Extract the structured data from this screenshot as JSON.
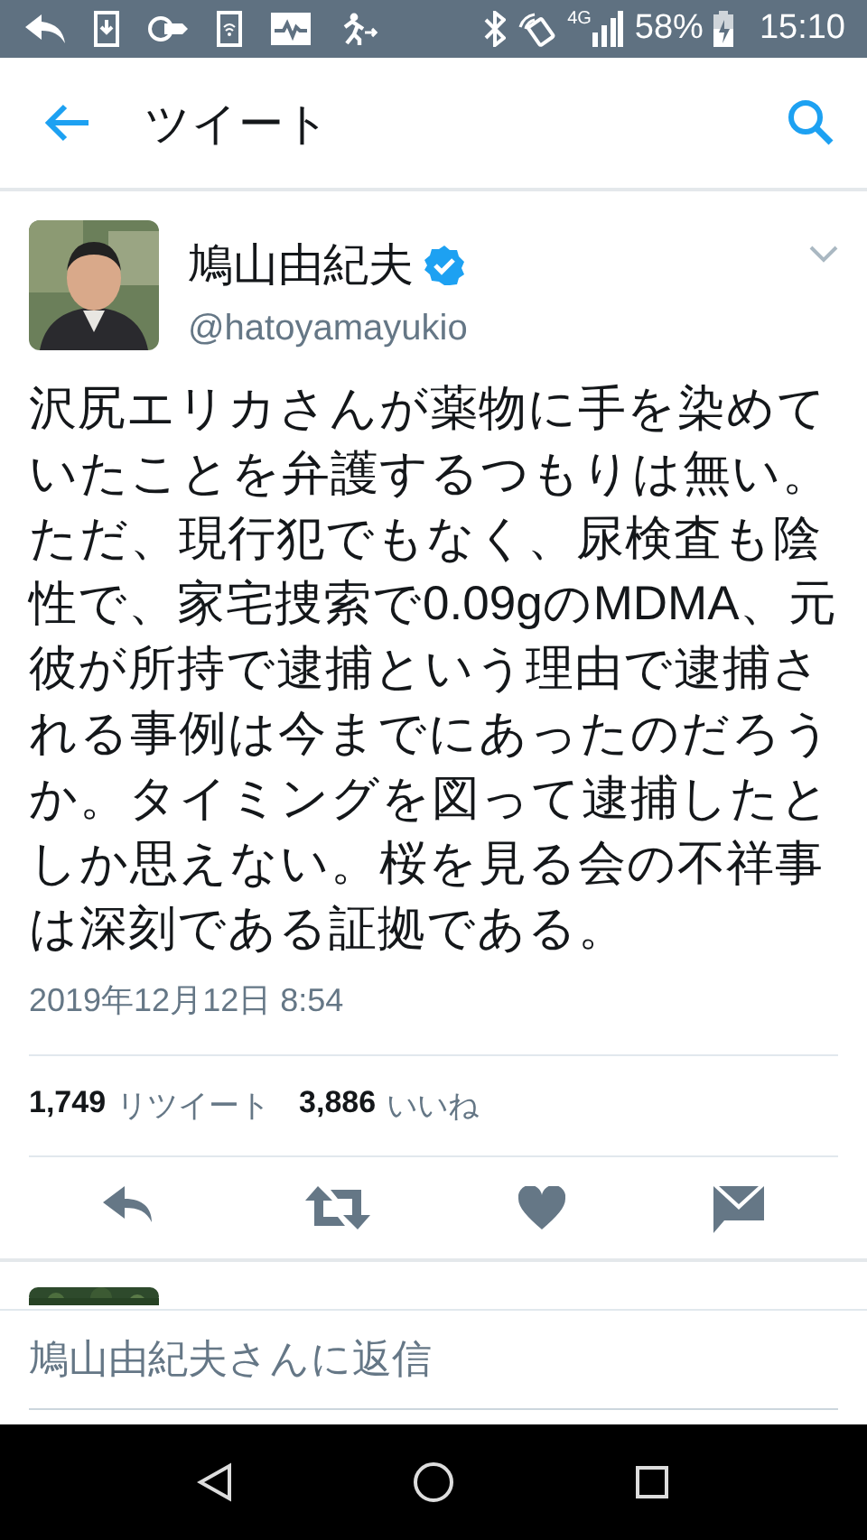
{
  "status_bar": {
    "network": "4G",
    "battery": "58%",
    "time": "15:10"
  },
  "header": {
    "title": "ツイート"
  },
  "tweet": {
    "name": "鳩山由紀夫",
    "verified": true,
    "handle": "@hatoyamayukio",
    "text": "沢尻エリカさんが薬物に手を染めていたことを弁護するつもりは無い。ただ、現行犯でもなく、尿検査も陰性で、家宅捜索で0.09gのMDMA、元彼が所持で逮捕という理由で逮捕される事例は今までにあったのだろうか。タイミングを図って逮捕したとしか思えない。桜を見る会の不祥事は深刻である証拠である。",
    "timestamp": "2019年12月12日 8:54",
    "stats": [
      {
        "count": "1,749",
        "label": "リツイート"
      },
      {
        "count": "3,886",
        "label": "いいね"
      }
    ]
  },
  "reply_bar": {
    "placeholder": "鳩山由紀夫さんに返信"
  }
}
